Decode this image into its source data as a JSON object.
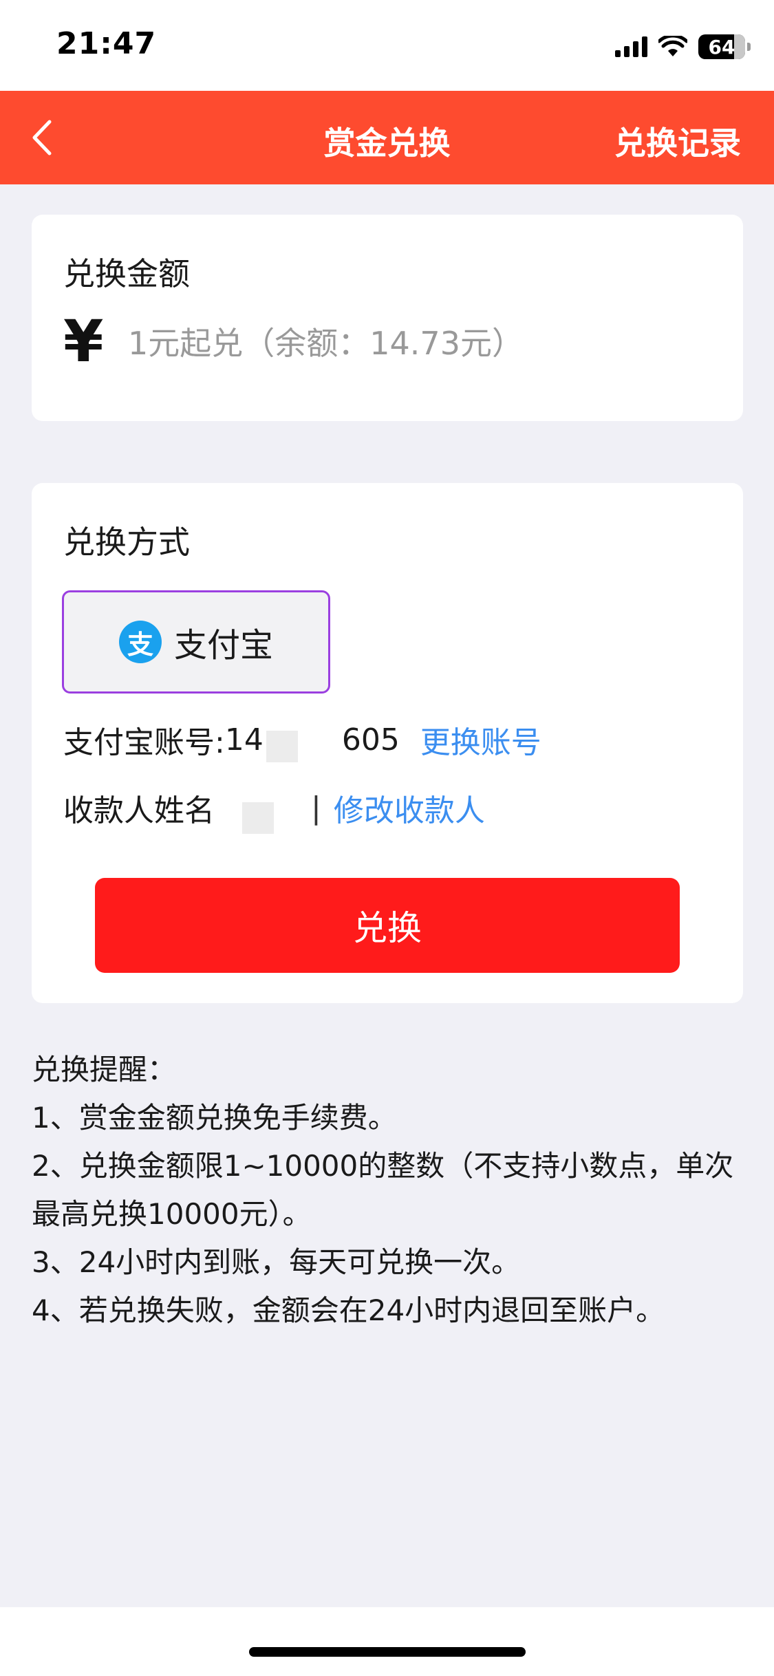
{
  "status_bar": {
    "time": "21:47",
    "battery": "64"
  },
  "nav": {
    "title": "赏金兑换",
    "right_action": "兑换记录"
  },
  "amount_card": {
    "title": "兑换金额",
    "currency_symbol": "¥",
    "placeholder": "1元起兑（余额：14.73元）"
  },
  "method_card": {
    "title": "兑换方式",
    "option_label": "支付宝",
    "option_icon_glyph": "支",
    "account_label": "支付宝账号:",
    "account_value_start": "14",
    "account_value_end": "605",
    "change_account": "更换账号",
    "payee_label": "收款人姓名",
    "payee_separator": "|",
    "edit_payee": "修改收款人",
    "submit_label": "兑换"
  },
  "notes": {
    "heading": "兑换提醒：",
    "items": [
      "1、赏金金额兑换免手续费。",
      "2、兑换金额限1~10000的整数（不支持小数点，单次最高兑换10000元）。",
      "3、24小时内到账，每天可兑换一次。",
      "4、若兑换失败，金额会在24小时内退回至账户。"
    ]
  },
  "colors": {
    "brand": "#fe4b2f",
    "button": "#ff1b1b",
    "link": "#3b8ef0",
    "selected_border": "#9b3fe0"
  }
}
